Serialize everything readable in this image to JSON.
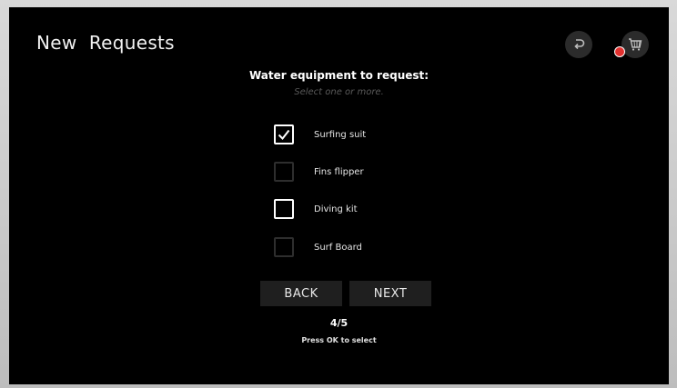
{
  "header": {
    "title": "New  Requests",
    "back_icon": "return-arrow-icon",
    "cart_icon": "cart-icon",
    "cart_badge_color": "#e2312f"
  },
  "form": {
    "heading": "Water equipment to request:",
    "subheading": "Select one or more.",
    "options": [
      {
        "label": "Surfing suit",
        "checked": true,
        "focused": false
      },
      {
        "label": "Fins flipper",
        "checked": false,
        "focused": false
      },
      {
        "label": "Diving kit",
        "checked": false,
        "focused": true
      },
      {
        "label": "Surf Board",
        "checked": false,
        "focused": false
      }
    ]
  },
  "buttons": {
    "back_label": "BACK",
    "next_label": "NEXT"
  },
  "footer": {
    "page_indicator": "4/5",
    "hint": "Press OK to select"
  }
}
